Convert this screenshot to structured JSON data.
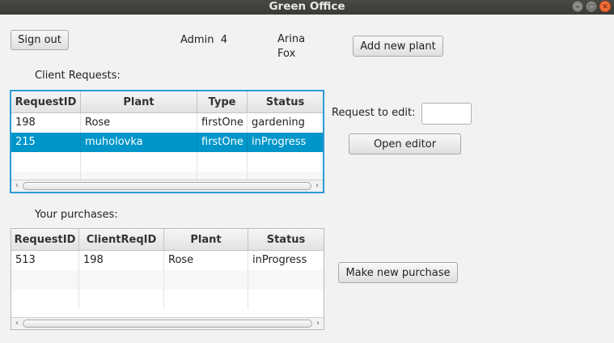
{
  "window": {
    "title": "Green Office"
  },
  "header": {
    "sign_out_label": "Sign out",
    "role": "Admin",
    "user_id": "4",
    "first_name": "Arina",
    "last_name": "Fox",
    "add_plant_label": "Add new plant"
  },
  "client_requests": {
    "title": "Client Requests:",
    "columns": [
      "RequestID",
      "Plant",
      "Type",
      "Status"
    ],
    "rows": [
      [
        "198",
        "Rose",
        "firstOne",
        "gardening"
      ],
      [
        "215",
        "muholovka",
        "firstOne",
        "inProgress"
      ]
    ],
    "selected_row_index": 1
  },
  "editor": {
    "request_label": "Request to edit:",
    "request_value": "",
    "open_editor_label": "Open editor"
  },
  "purchases": {
    "title": "Your purchases:",
    "columns": [
      "RequestID",
      "ClientReqID",
      "Plant",
      "Status"
    ],
    "rows": [
      [
        "513",
        "198",
        "Rose",
        "inProgress"
      ]
    ],
    "make_purchase_label": "Make new purchase"
  }
}
